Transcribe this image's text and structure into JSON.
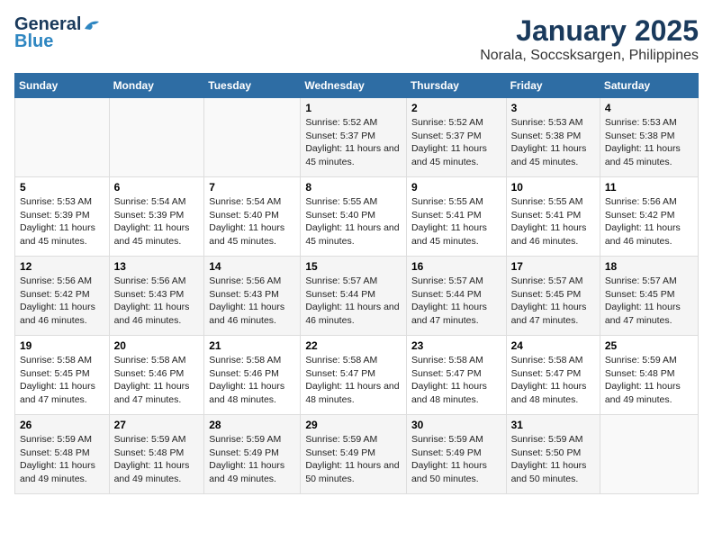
{
  "header": {
    "logo_line1": "General",
    "logo_line2": "Blue",
    "month": "January 2025",
    "location": "Norala, Soccsksargen, Philippines"
  },
  "weekdays": [
    "Sunday",
    "Monday",
    "Tuesday",
    "Wednesday",
    "Thursday",
    "Friday",
    "Saturday"
  ],
  "weeks": [
    [
      {
        "day": "",
        "sunrise": "",
        "sunset": "",
        "daylight": ""
      },
      {
        "day": "",
        "sunrise": "",
        "sunset": "",
        "daylight": ""
      },
      {
        "day": "",
        "sunrise": "",
        "sunset": "",
        "daylight": ""
      },
      {
        "day": "1",
        "sunrise": "Sunrise: 5:52 AM",
        "sunset": "Sunset: 5:37 PM",
        "daylight": "Daylight: 11 hours and 45 minutes."
      },
      {
        "day": "2",
        "sunrise": "Sunrise: 5:52 AM",
        "sunset": "Sunset: 5:37 PM",
        "daylight": "Daylight: 11 hours and 45 minutes."
      },
      {
        "day": "3",
        "sunrise": "Sunrise: 5:53 AM",
        "sunset": "Sunset: 5:38 PM",
        "daylight": "Daylight: 11 hours and 45 minutes."
      },
      {
        "day": "4",
        "sunrise": "Sunrise: 5:53 AM",
        "sunset": "Sunset: 5:38 PM",
        "daylight": "Daylight: 11 hours and 45 minutes."
      }
    ],
    [
      {
        "day": "5",
        "sunrise": "Sunrise: 5:53 AM",
        "sunset": "Sunset: 5:39 PM",
        "daylight": "Daylight: 11 hours and 45 minutes."
      },
      {
        "day": "6",
        "sunrise": "Sunrise: 5:54 AM",
        "sunset": "Sunset: 5:39 PM",
        "daylight": "Daylight: 11 hours and 45 minutes."
      },
      {
        "day": "7",
        "sunrise": "Sunrise: 5:54 AM",
        "sunset": "Sunset: 5:40 PM",
        "daylight": "Daylight: 11 hours and 45 minutes."
      },
      {
        "day": "8",
        "sunrise": "Sunrise: 5:55 AM",
        "sunset": "Sunset: 5:40 PM",
        "daylight": "Daylight: 11 hours and 45 minutes."
      },
      {
        "day": "9",
        "sunrise": "Sunrise: 5:55 AM",
        "sunset": "Sunset: 5:41 PM",
        "daylight": "Daylight: 11 hours and 45 minutes."
      },
      {
        "day": "10",
        "sunrise": "Sunrise: 5:55 AM",
        "sunset": "Sunset: 5:41 PM",
        "daylight": "Daylight: 11 hours and 46 minutes."
      },
      {
        "day": "11",
        "sunrise": "Sunrise: 5:56 AM",
        "sunset": "Sunset: 5:42 PM",
        "daylight": "Daylight: 11 hours and 46 minutes."
      }
    ],
    [
      {
        "day": "12",
        "sunrise": "Sunrise: 5:56 AM",
        "sunset": "Sunset: 5:42 PM",
        "daylight": "Daylight: 11 hours and 46 minutes."
      },
      {
        "day": "13",
        "sunrise": "Sunrise: 5:56 AM",
        "sunset": "Sunset: 5:43 PM",
        "daylight": "Daylight: 11 hours and 46 minutes."
      },
      {
        "day": "14",
        "sunrise": "Sunrise: 5:56 AM",
        "sunset": "Sunset: 5:43 PM",
        "daylight": "Daylight: 11 hours and 46 minutes."
      },
      {
        "day": "15",
        "sunrise": "Sunrise: 5:57 AM",
        "sunset": "Sunset: 5:44 PM",
        "daylight": "Daylight: 11 hours and 46 minutes."
      },
      {
        "day": "16",
        "sunrise": "Sunrise: 5:57 AM",
        "sunset": "Sunset: 5:44 PM",
        "daylight": "Daylight: 11 hours and 47 minutes."
      },
      {
        "day": "17",
        "sunrise": "Sunrise: 5:57 AM",
        "sunset": "Sunset: 5:45 PM",
        "daylight": "Daylight: 11 hours and 47 minutes."
      },
      {
        "day": "18",
        "sunrise": "Sunrise: 5:57 AM",
        "sunset": "Sunset: 5:45 PM",
        "daylight": "Daylight: 11 hours and 47 minutes."
      }
    ],
    [
      {
        "day": "19",
        "sunrise": "Sunrise: 5:58 AM",
        "sunset": "Sunset: 5:45 PM",
        "daylight": "Daylight: 11 hours and 47 minutes."
      },
      {
        "day": "20",
        "sunrise": "Sunrise: 5:58 AM",
        "sunset": "Sunset: 5:46 PM",
        "daylight": "Daylight: 11 hours and 47 minutes."
      },
      {
        "day": "21",
        "sunrise": "Sunrise: 5:58 AM",
        "sunset": "Sunset: 5:46 PM",
        "daylight": "Daylight: 11 hours and 48 minutes."
      },
      {
        "day": "22",
        "sunrise": "Sunrise: 5:58 AM",
        "sunset": "Sunset: 5:47 PM",
        "daylight": "Daylight: 11 hours and 48 minutes."
      },
      {
        "day": "23",
        "sunrise": "Sunrise: 5:58 AM",
        "sunset": "Sunset: 5:47 PM",
        "daylight": "Daylight: 11 hours and 48 minutes."
      },
      {
        "day": "24",
        "sunrise": "Sunrise: 5:58 AM",
        "sunset": "Sunset: 5:47 PM",
        "daylight": "Daylight: 11 hours and 48 minutes."
      },
      {
        "day": "25",
        "sunrise": "Sunrise: 5:59 AM",
        "sunset": "Sunset: 5:48 PM",
        "daylight": "Daylight: 11 hours and 49 minutes."
      }
    ],
    [
      {
        "day": "26",
        "sunrise": "Sunrise: 5:59 AM",
        "sunset": "Sunset: 5:48 PM",
        "daylight": "Daylight: 11 hours and 49 minutes."
      },
      {
        "day": "27",
        "sunrise": "Sunrise: 5:59 AM",
        "sunset": "Sunset: 5:48 PM",
        "daylight": "Daylight: 11 hours and 49 minutes."
      },
      {
        "day": "28",
        "sunrise": "Sunrise: 5:59 AM",
        "sunset": "Sunset: 5:49 PM",
        "daylight": "Daylight: 11 hours and 49 minutes."
      },
      {
        "day": "29",
        "sunrise": "Sunrise: 5:59 AM",
        "sunset": "Sunset: 5:49 PM",
        "daylight": "Daylight: 11 hours and 50 minutes."
      },
      {
        "day": "30",
        "sunrise": "Sunrise: 5:59 AM",
        "sunset": "Sunset: 5:49 PM",
        "daylight": "Daylight: 11 hours and 50 minutes."
      },
      {
        "day": "31",
        "sunrise": "Sunrise: 5:59 AM",
        "sunset": "Sunset: 5:50 PM",
        "daylight": "Daylight: 11 hours and 50 minutes."
      },
      {
        "day": "",
        "sunrise": "",
        "sunset": "",
        "daylight": ""
      }
    ]
  ]
}
